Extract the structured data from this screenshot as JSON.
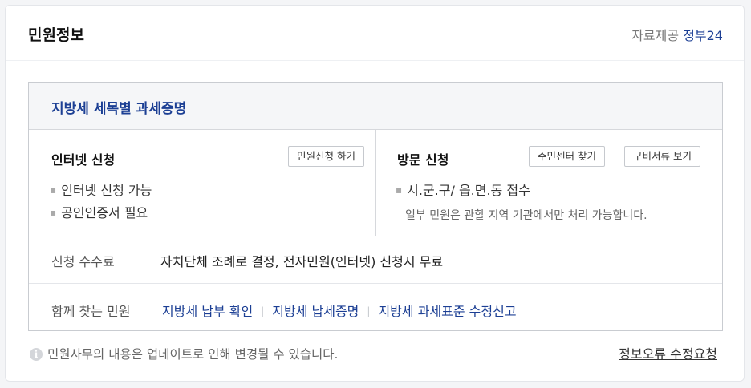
{
  "header": {
    "title": "민원정보",
    "provider_prefix": "자료제공",
    "provider_brand": "정부24"
  },
  "service": {
    "title": "지방세 세목별 과세증명",
    "internet": {
      "title": "인터넷 신청",
      "button": "민원신청 하기",
      "items": [
        "인터넷 신청 가능",
        "공인인증서 필요"
      ]
    },
    "visit": {
      "title": "방문 신청",
      "buttons": [
        "주민센터 찾기",
        "구비서류 보기"
      ],
      "items": [
        "시.군.구/ 읍.면.동 접수"
      ],
      "note": "일부 민원은 관할 지역 기관에서만 처리 가능합니다."
    }
  },
  "fee": {
    "label": "신청 수수료",
    "value": "자치단체 조례로 결정, 전자민원(인터넷) 신청시 무료"
  },
  "related": {
    "label": "함께 찾는 민원",
    "links": [
      "지방세 납부 확인",
      "지방세 납세증명",
      "지방세 과세표준 수정신고"
    ]
  },
  "footer": {
    "note": "민원사무의 내용은 업데이트로 인해 변경될 수 있습니다.",
    "report_link": "정보오류 수정요청"
  },
  "colors": {
    "accent": "#1c3f94",
    "border": "#c9ccd1"
  }
}
